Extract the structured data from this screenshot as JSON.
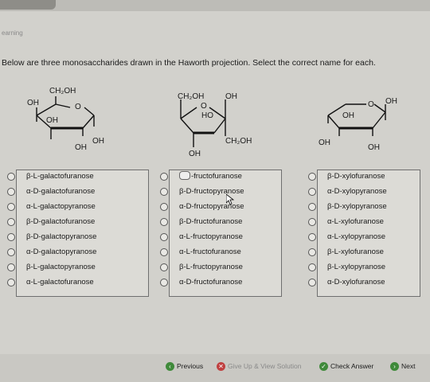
{
  "app": {
    "brand": "earning"
  },
  "question": {
    "instructions": "Below are three monosaccharides drawn in the Haworth projection.  Select the correct name for each."
  },
  "structures": [
    {
      "labels": [
        "CH₂OH",
        "OH",
        "O",
        "OH",
        "OH",
        "OH"
      ]
    },
    {
      "labels": [
        "CH₂OH",
        "OH",
        "O",
        "HO",
        "CH₂OH",
        "OH"
      ]
    },
    {
      "labels": [
        "O",
        "OH",
        "OH",
        "OH",
        "OH"
      ]
    }
  ],
  "choices": [
    {
      "options": [
        "β-L-galactofuranose",
        "α-D-galactofuranose",
        "α-L-galactopyranose",
        "β-D-galactofuranose",
        "β-D-galactopyranose",
        "α-D-galactopyranose",
        "β-L-galactopyranose",
        "α-L-galactofuranose"
      ]
    },
    {
      "options": [
        "-fructofuranose",
        "β-D-fructopyranose",
        "α-D-fructopyranose",
        "β-D-fructofuranose",
        "α-L-fructopyranose",
        "α-L-fructofuranose",
        "β-L-fructopyranose",
        "α-D-fructofuranose"
      ]
    },
    {
      "options": [
        "β-D-xylofuranose",
        "α-D-xylopyranose",
        "β-D-xylopyranose",
        "α-L-xylofuranose",
        "α-L-xylopyranose",
        "β-L-xylofuranose",
        "β-L-xylopyranose",
        "α-D-xylofuranose"
      ]
    }
  ],
  "footer": {
    "previous": "Previous",
    "give_up": "Give Up & View Solution",
    "check": "Check Answer",
    "next": "Next"
  },
  "icons": [
    "chat-icon",
    "cursor-icon",
    "previous-icon",
    "give-up-icon",
    "check-icon",
    "next-icon"
  ]
}
